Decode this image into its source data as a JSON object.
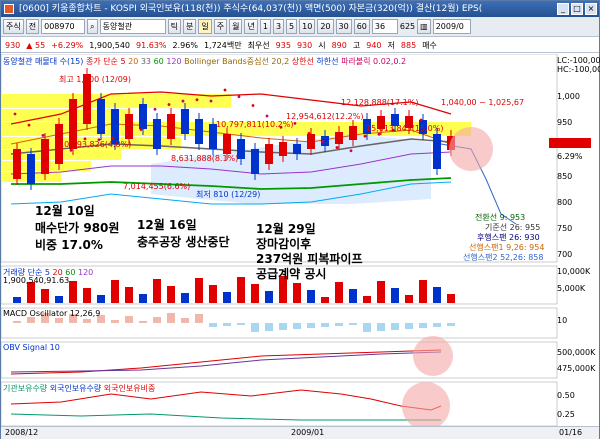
{
  "window": {
    "title": "[0600] 키움종합차트 - KOSPI 외국인보유(118(천)) 주식수(64,037(천)) 액면(500) 자본금(320(억)) 결산(12월) EPS(",
    "buttons": [
      "_",
      "□",
      "×"
    ]
  },
  "toolbar": {
    "market": "주식",
    "prev_label": "전",
    "code": "008970",
    "name": "동양철관",
    "periods": [
      "틱",
      "분",
      "일",
      "주",
      "월",
      "년"
    ],
    "numbers": [
      "1",
      "3",
      "5",
      "10",
      "20",
      "30",
      "60"
    ],
    "count": "36",
    "page": "625",
    "date": "2009/0"
  },
  "info": {
    "price": "930",
    "change": "▲ 55",
    "change_pct": "+6.29%",
    "volume": "1,900,540",
    "vol_ratio": "91.63%",
    "turnover": "2.96%",
    "amount": "1,724백만",
    "best_label": "최우선",
    "best_ask": "935",
    "best_bid": "930",
    "open_label": "시",
    "open": "890",
    "high_label": "고",
    "high": "940",
    "low_label": "저",
    "low": "885",
    "buy_label": "매수"
  },
  "price_panel": {
    "legend": [
      "동양철관 매물대 수(15)",
      "종가 단순 5",
      "20",
      "33",
      "60",
      "120",
      "Bollinger Bands중심선 20,2",
      "상한선",
      "하한선",
      "파라볼릭 0.02,0.2",
      "전환"
    ],
    "lc": "LC:-100,00",
    "hc": "HC:-100,00",
    "labels": {
      "high_box": "최고 1,100 (12/09)",
      "low_box": "최저 810 (12/29)",
      "vp1": "12,128,888(17.1%)",
      "vp2": "10,797,811(10.2%)",
      "vp3": "12,954,612(12.2%)",
      "vp4": "10,993,826(4.8%)",
      "vp5": "8,631,888(8.1%)",
      "vp6": "7,014,455(6.6%)",
      "vp7": "15,013,843(15.0%)",
      "range": "1,040,00 ~ 1,025,67"
    },
    "scale": [
      "1,000",
      "950",
      "900",
      "850",
      "800",
      "750",
      "700"
    ],
    "current": "930",
    "current_pct": "6.29%",
    "ichimoku": [
      {
        "label": "전환선 9:",
        "value": "953",
        "color": "#006600"
      },
      {
        "label": "기준선 26:",
        "value": "955",
        "color": "#333333"
      },
      {
        "label": "후행스팬 26:",
        "value": "930",
        "color": "#000080"
      },
      {
        "label": "선행스팬1 9,26:",
        "value": "954",
        "color": "#cc6600"
      },
      {
        "label": "선행스팬2 52,26:",
        "value": "858",
        "color": "#3366cc"
      }
    ]
  },
  "annotations": {
    "a1": [
      "12월 10일",
      "매수단가 980원",
      "비중 17.0%"
    ],
    "a2": [
      "12월 16일",
      "충주공장 생산중단"
    ],
    "a3": [
      "12월 29일",
      "장마감이후",
      "237억원 피복파이프",
      "공급계약 공시"
    ]
  },
  "volume_panel": {
    "legend": [
      "거래량 단순 5",
      "20",
      "60",
      "120"
    ],
    "value_label": "1,900,540,91.63",
    "scale": [
      "10,000K",
      "5,000K"
    ]
  },
  "macd_panel": {
    "legend": "MACD Oscillator 12,26,9",
    "scale": [
      "10"
    ]
  },
  "obv_panel": {
    "legend": "OBV  Signal 10",
    "scale": [
      "500,000K",
      "475,000K"
    ]
  },
  "inst_panel": {
    "legend": [
      "기관보유수량",
      "외국인보유수량",
      "외국인보유비중"
    ],
    "scale": [
      "0.50",
      "0.25"
    ]
  },
  "status": {
    "left": "2008/12",
    "mid": "2009/01",
    "right": "01/16"
  },
  "colors": {
    "up": "#e00000",
    "down": "#0033cc",
    "volume_profile": "#ffff33",
    "highlight": "#f4a6a6"
  }
}
